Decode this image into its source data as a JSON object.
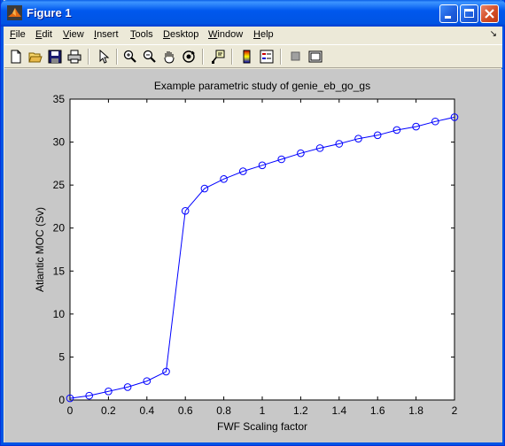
{
  "window": {
    "title": "Figure 1"
  },
  "menu": {
    "items": [
      "File",
      "Edit",
      "View",
      "Insert",
      "Tools",
      "Desktop",
      "Window",
      "Help"
    ],
    "dock_glyph": "↘"
  },
  "toolbar": {
    "icons": [
      "new-figure-icon",
      "open-file-icon",
      "save-icon",
      "print-icon",
      "edit-plot-arrow-icon",
      "zoom-in-icon",
      "zoom-out-icon",
      "pan-hand-icon",
      "rotate-3d-icon",
      "data-cursor-icon",
      "colorbar-icon",
      "legend-icon",
      "hide-plot-tools-icon",
      "show-plot-tools-icon"
    ]
  },
  "colors": {
    "line": "#0000ff",
    "axes_bg": "#ffffff",
    "figure_bg": "#c8c8c8",
    "titlebar": "#0054e3"
  },
  "chart_data": {
    "type": "line",
    "title": "Example parametric study of genie_eb_go_gs",
    "xlabel": "FWF Scaling factor",
    "ylabel": "Atlantic MOC (Sv)",
    "xlim": [
      0,
      2
    ],
    "ylim": [
      0,
      35
    ],
    "xticks": [
      "0",
      "0.2",
      "0.4",
      "0.6",
      "0.8",
      "1",
      "1.2",
      "1.4",
      "1.6",
      "1.8",
      "2"
    ],
    "yticks": [
      "0",
      "5",
      "10",
      "15",
      "20",
      "25",
      "30",
      "35"
    ],
    "marker": "circle",
    "grid": false,
    "series": [
      {
        "x": [
          0,
          0.1,
          0.2,
          0.3,
          0.4,
          0.5,
          0.6,
          0.7,
          0.8,
          0.9,
          1.0,
          1.1,
          1.2,
          1.3,
          1.4,
          1.5,
          1.6,
          1.7,
          1.8,
          1.9,
          2.0
        ],
        "values": [
          0.2,
          0.5,
          1.0,
          1.5,
          2.2,
          3.3,
          22.0,
          24.6,
          25.7,
          26.6,
          27.3,
          28.0,
          28.7,
          29.3,
          29.8,
          30.4,
          30.8,
          31.4,
          31.8,
          32.4,
          32.9
        ]
      }
    ]
  }
}
